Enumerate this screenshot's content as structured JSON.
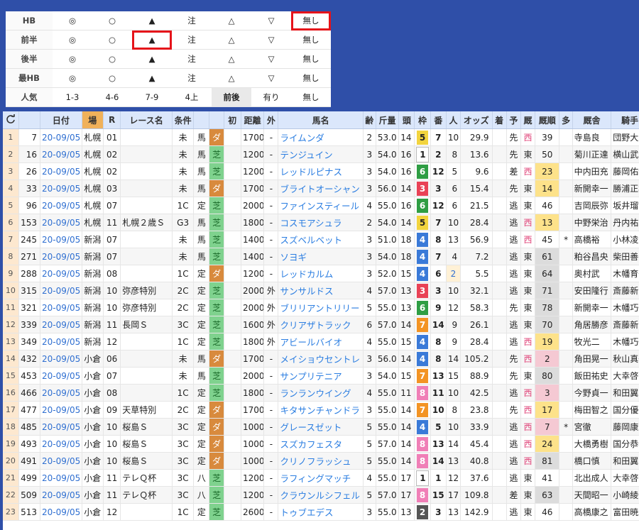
{
  "legend": {
    "rows": [
      {
        "label": "HB",
        "cells": [
          "◎",
          "○",
          "▲",
          "注",
          "△",
          "▽",
          "無し"
        ]
      },
      {
        "label": "前半",
        "cells": [
          "◎",
          "○",
          "▲",
          "注",
          "△",
          "▽",
          "無し"
        ]
      },
      {
        "label": "後半",
        "cells": [
          "◎",
          "○",
          "▲",
          "注",
          "△",
          "▽",
          "無し"
        ]
      },
      {
        "label": "最HB",
        "cells": [
          "◎",
          "○",
          "▲",
          "注",
          "△",
          "▽",
          "無し"
        ]
      },
      {
        "label": "人気",
        "cells": [
          "1-3",
          "4-6",
          "7-9",
          "4上",
          "前後",
          "有り",
          "無し"
        ]
      }
    ]
  },
  "grid": {
    "refresh_icon": "refresh-icon",
    "headers": [
      "",
      "日付",
      "場",
      "R",
      "レース名",
      "条件",
      "",
      "",
      "初",
      "距離",
      "外",
      "馬名",
      "齢",
      "斤量",
      "頭",
      "枠",
      "番",
      "人",
      "オッズ",
      "着",
      "予",
      "厩",
      "厩順",
      "多",
      "厩舎",
      "騎手"
    ],
    "rows": [
      {
        "idx": "1",
        "id": "7",
        "date": "20-09/05",
        "venue": "札幌",
        "r": "01",
        "race": "",
        "cond": "未",
        "ctype": "馬",
        "surf": "ダ",
        "first": "",
        "dist": "1700",
        "outer": "-",
        "horse": "ライムンダ",
        "age": "2",
        "weight": "53.0",
        "heads": "14",
        "frame": "5",
        "num": "7",
        "pop": "10",
        "odds": "29.9",
        "fin": "",
        "pred": "先",
        "barn": "西",
        "brank": "39",
        "multi": "",
        "trainer": "寺島良",
        "jockey": "団野大成"
      },
      {
        "idx": "2",
        "id": "16",
        "date": "20-09/05",
        "venue": "札幌",
        "r": "02",
        "race": "",
        "cond": "未",
        "ctype": "馬",
        "surf": "芝",
        "first": "",
        "dist": "1200",
        "outer": "-",
        "horse": "テンジュイン",
        "age": "3",
        "weight": "54.0",
        "heads": "16",
        "frame": "1",
        "num": "2",
        "pop": "8",
        "odds": "13.6",
        "fin": "",
        "pred": "先",
        "barn": "東",
        "brank": "50",
        "multi": "",
        "trainer": "菊川正達",
        "jockey": "横山武史"
      },
      {
        "idx": "3",
        "id": "26",
        "date": "20-09/05",
        "venue": "札幌",
        "r": "02",
        "race": "",
        "cond": "未",
        "ctype": "馬",
        "surf": "芝",
        "first": "",
        "dist": "1200",
        "outer": "-",
        "horse": "レッドルピナス",
        "age": "3",
        "weight": "54.0",
        "heads": "16",
        "frame": "6",
        "num": "12",
        "pop": "5",
        "odds": "9.6",
        "fin": "",
        "pred": "差",
        "barn": "西",
        "brank": "23",
        "multi": "",
        "trainer": "中内田充",
        "jockey": "藤岡佑介"
      },
      {
        "idx": "4",
        "id": "33",
        "date": "20-09/05",
        "venue": "札幌",
        "r": "03",
        "race": "",
        "cond": "未",
        "ctype": "馬",
        "surf": "ダ",
        "first": "",
        "dist": "1700",
        "outer": "-",
        "horse": "ブライトオーシャン",
        "age": "3",
        "weight": "56.0",
        "heads": "14",
        "frame": "3",
        "num": "3",
        "pop": "6",
        "odds": "15.4",
        "fin": "",
        "pred": "先",
        "barn": "東",
        "brank": "14",
        "multi": "",
        "trainer": "新開幸一",
        "jockey": "勝浦正樹"
      },
      {
        "idx": "5",
        "id": "96",
        "date": "20-09/05",
        "venue": "札幌",
        "r": "07",
        "race": "",
        "cond": "1C",
        "ctype": "定",
        "surf": "芝",
        "first": "",
        "dist": "2000",
        "outer": "-",
        "horse": "ファインスティール",
        "age": "4",
        "weight": "55.0",
        "heads": "16",
        "frame": "6",
        "num": "12",
        "pop": "6",
        "odds": "21.5",
        "fin": "",
        "pred": "逃",
        "barn": "東",
        "brank": "46",
        "multi": "",
        "trainer": "吉岡辰弥",
        "jockey": "坂井瑠星"
      },
      {
        "idx": "6",
        "id": "153",
        "date": "20-09/05",
        "venue": "札幌",
        "r": "11",
        "race": "札幌２歳Ｓ",
        "cond": "G3",
        "ctype": "馬",
        "surf": "芝",
        "first": "",
        "dist": "1800",
        "outer": "-",
        "horse": "コスモアシュラ",
        "age": "2",
        "weight": "54.0",
        "heads": "14",
        "frame": "5",
        "num": "7",
        "pop": "10",
        "odds": "28.4",
        "fin": "",
        "pred": "逃",
        "barn": "西",
        "brank": "13",
        "multi": "",
        "trainer": "中野栄治",
        "jockey": "丹内祐次"
      },
      {
        "idx": "7",
        "id": "245",
        "date": "20-09/05",
        "venue": "新潟",
        "r": "07",
        "race": "",
        "cond": "未",
        "ctype": "馬",
        "surf": "芝",
        "first": "",
        "dist": "1400",
        "outer": "-",
        "horse": "スズベルベット",
        "age": "3",
        "weight": "51.0",
        "heads": "18",
        "frame": "4",
        "num": "8",
        "pop": "13",
        "odds": "56.9",
        "fin": "",
        "pred": "逃",
        "barn": "西",
        "brank": "45",
        "multi": "*",
        "trainer": "高橋裕",
        "jockey": "小林凌大"
      },
      {
        "idx": "8",
        "id": "271",
        "date": "20-09/05",
        "venue": "新潟",
        "r": "07",
        "race": "",
        "cond": "未",
        "ctype": "馬",
        "surf": "芝",
        "first": "",
        "dist": "1400",
        "outer": "-",
        "horse": "ソヨギ",
        "age": "3",
        "weight": "54.0",
        "heads": "18",
        "frame": "4",
        "num": "7",
        "pop": "4",
        "odds": "7.2",
        "fin": "",
        "pred": "逃",
        "barn": "東",
        "brank": "61",
        "multi": "",
        "trainer": "粕谷昌央",
        "jockey": "柴田善臣"
      },
      {
        "idx": "9",
        "id": "288",
        "date": "20-09/05",
        "venue": "新潟",
        "r": "08",
        "race": "",
        "cond": "1C",
        "ctype": "定",
        "surf": "ダ",
        "first": "",
        "dist": "1200",
        "outer": "-",
        "horse": "レッドカルム",
        "age": "3",
        "weight": "52.0",
        "heads": "15",
        "frame": "4",
        "num": "6",
        "pop": "2",
        "odds": "5.5",
        "fin": "",
        "pred": "逃",
        "barn": "東",
        "brank": "64",
        "multi": "",
        "trainer": "奥村武",
        "jockey": "木幡育也"
      },
      {
        "idx": "10",
        "id": "315",
        "date": "20-09/05",
        "venue": "新潟",
        "r": "10",
        "race": "弥彦特別",
        "cond": "2C",
        "ctype": "定",
        "surf": "芝",
        "first": "",
        "dist": "2000",
        "outer": "外",
        "horse": "サンサルドス",
        "age": "4",
        "weight": "57.0",
        "heads": "13",
        "frame": "3",
        "num": "3",
        "pop": "10",
        "odds": "32.1",
        "fin": "",
        "pred": "逃",
        "barn": "東",
        "brank": "71",
        "multi": "",
        "trainer": "安田隆行",
        "jockey": "斎藤新"
      },
      {
        "idx": "11",
        "id": "321",
        "date": "20-09/05",
        "venue": "新潟",
        "r": "10",
        "race": "弥彦特別",
        "cond": "2C",
        "ctype": "定",
        "surf": "芝",
        "first": "",
        "dist": "2000",
        "outer": "外",
        "horse": "ブリリアントリリー",
        "age": "5",
        "weight": "55.0",
        "heads": "13",
        "frame": "6",
        "num": "9",
        "pop": "12",
        "odds": "58.3",
        "fin": "",
        "pred": "先",
        "barn": "東",
        "brank": "78",
        "multi": "",
        "trainer": "新開幸一",
        "jockey": "木幡巧也"
      },
      {
        "idx": "12",
        "id": "339",
        "date": "20-09/05",
        "venue": "新潟",
        "r": "11",
        "race": "長岡Ｓ",
        "cond": "3C",
        "ctype": "定",
        "surf": "芝",
        "first": "",
        "dist": "1600",
        "outer": "外",
        "horse": "クリアザトラック",
        "age": "6",
        "weight": "57.0",
        "heads": "14",
        "frame": "7",
        "num": "14",
        "pop": "9",
        "odds": "26.1",
        "fin": "",
        "pred": "逃",
        "barn": "東",
        "brank": "70",
        "multi": "",
        "trainer": "角居勝彦",
        "jockey": "斎藤新"
      },
      {
        "idx": "13",
        "id": "349",
        "date": "20-09/05",
        "venue": "新潟",
        "r": "12",
        "race": "",
        "cond": "1C",
        "ctype": "定",
        "surf": "芝",
        "first": "",
        "dist": "1800",
        "outer": "外",
        "horse": "アビールバイオ",
        "age": "4",
        "weight": "55.0",
        "heads": "15",
        "frame": "4",
        "num": "8",
        "pop": "9",
        "odds": "28.4",
        "fin": "",
        "pred": "逃",
        "barn": "西",
        "brank": "19",
        "multi": "",
        "trainer": "牧光二",
        "jockey": "木幡巧也"
      },
      {
        "idx": "14",
        "id": "432",
        "date": "20-09/05",
        "venue": "小倉",
        "r": "06",
        "race": "",
        "cond": "未",
        "ctype": "馬",
        "surf": "ダ",
        "first": "",
        "dist": "1700",
        "outer": "-",
        "horse": "メイショウセントレ",
        "age": "3",
        "weight": "56.0",
        "heads": "14",
        "frame": "4",
        "num": "8",
        "pop": "14",
        "odds": "105.2",
        "fin": "",
        "pred": "先",
        "barn": "西",
        "brank": "2",
        "multi": "",
        "trainer": "角田晃一",
        "jockey": "秋山真一"
      },
      {
        "idx": "15",
        "id": "453",
        "date": "20-09/05",
        "venue": "小倉",
        "r": "07",
        "race": "",
        "cond": "未",
        "ctype": "馬",
        "surf": "芝",
        "first": "",
        "dist": "2000",
        "outer": "-",
        "horse": "サンプリテニア",
        "age": "3",
        "weight": "54.0",
        "heads": "15",
        "frame": "7",
        "num": "13",
        "pop": "15",
        "odds": "88.9",
        "fin": "",
        "pred": "先",
        "barn": "東",
        "brank": "80",
        "multi": "",
        "trainer": "飯田祐史",
        "jockey": "大幸啓介"
      },
      {
        "idx": "16",
        "id": "466",
        "date": "20-09/05",
        "venue": "小倉",
        "r": "08",
        "race": "",
        "cond": "1C",
        "ctype": "定",
        "surf": "芝",
        "first": "",
        "dist": "1800",
        "outer": "-",
        "horse": "ランランウイング",
        "age": "4",
        "weight": "55.0",
        "heads": "11",
        "frame": "8",
        "num": "11",
        "pop": "10",
        "odds": "42.5",
        "fin": "",
        "pred": "逃",
        "barn": "西",
        "brank": "3",
        "multi": "",
        "trainer": "今野貞一",
        "jockey": "和田翼"
      },
      {
        "idx": "17",
        "id": "477",
        "date": "20-09/05",
        "venue": "小倉",
        "r": "09",
        "race": "天草特別",
        "cond": "2C",
        "ctype": "定",
        "surf": "ダ",
        "first": "",
        "dist": "1700",
        "outer": "-",
        "horse": "キタサンチャンドラ",
        "age": "3",
        "weight": "55.0",
        "heads": "14",
        "frame": "7",
        "num": "10",
        "pop": "8",
        "odds": "23.8",
        "fin": "",
        "pred": "先",
        "barn": "西",
        "brank": "17",
        "multi": "",
        "trainer": "梅田智之",
        "jockey": "国分優作"
      },
      {
        "idx": "18",
        "id": "485",
        "date": "20-09/05",
        "venue": "小倉",
        "r": "10",
        "race": "桜島Ｓ",
        "cond": "3C",
        "ctype": "定",
        "surf": "ダ",
        "first": "",
        "dist": "1000",
        "outer": "-",
        "horse": "グレースゼット",
        "age": "5",
        "weight": "55.0",
        "heads": "14",
        "frame": "4",
        "num": "5",
        "pop": "10",
        "odds": "33.9",
        "fin": "",
        "pred": "逃",
        "barn": "西",
        "brank": "7",
        "multi": "*",
        "trainer": "宮徹",
        "jockey": "藤岡康太"
      },
      {
        "idx": "19",
        "id": "493",
        "date": "20-09/05",
        "venue": "小倉",
        "r": "10",
        "race": "桜島Ｓ",
        "cond": "3C",
        "ctype": "定",
        "surf": "ダ",
        "first": "",
        "dist": "1000",
        "outer": "-",
        "horse": "スズカフェスタ",
        "age": "5",
        "weight": "57.0",
        "heads": "14",
        "frame": "8",
        "num": "13",
        "pop": "14",
        "odds": "45.4",
        "fin": "",
        "pred": "逃",
        "barn": "西",
        "brank": "24",
        "multi": "",
        "trainer": "大橋勇樹",
        "jockey": "国分恭介"
      },
      {
        "idx": "20",
        "id": "491",
        "date": "20-09/05",
        "venue": "小倉",
        "r": "10",
        "race": "桜島Ｓ",
        "cond": "3C",
        "ctype": "定",
        "surf": "ダ",
        "first": "",
        "dist": "1000",
        "outer": "-",
        "horse": "クリノフラッシュ",
        "age": "5",
        "weight": "55.0",
        "heads": "14",
        "frame": "8",
        "num": "14",
        "pop": "13",
        "odds": "40.8",
        "fin": "",
        "pred": "逃",
        "barn": "西",
        "brank": "81",
        "multi": "",
        "trainer": "橋口慎",
        "jockey": "和田翼"
      },
      {
        "idx": "21",
        "id": "499",
        "date": "20-09/05",
        "venue": "小倉",
        "r": "11",
        "race": "テレＱ杯",
        "cond": "3C",
        "ctype": "八",
        "surf": "芝",
        "first": "",
        "dist": "1200",
        "outer": "-",
        "horse": "ラフィングマッチ",
        "age": "4",
        "weight": "55.0",
        "heads": "17",
        "frame": "1",
        "num": "1",
        "pop": "12",
        "odds": "37.6",
        "fin": "",
        "pred": "逃",
        "barn": "東",
        "brank": "41",
        "multi": "",
        "trainer": "北出成人",
        "jockey": "大幸啓介"
      },
      {
        "idx": "22",
        "id": "509",
        "date": "20-09/05",
        "venue": "小倉",
        "r": "11",
        "race": "テレＱ杯",
        "cond": "3C",
        "ctype": "八",
        "surf": "芝",
        "first": "",
        "dist": "1200",
        "outer": "-",
        "horse": "クラウンルシフェル",
        "age": "5",
        "weight": "57.0",
        "heads": "17",
        "frame": "8",
        "num": "15",
        "pop": "17",
        "odds": "109.8",
        "fin": "",
        "pred": "差",
        "barn": "東",
        "brank": "63",
        "multi": "",
        "trainer": "天間昭一",
        "jockey": "小崎綾也"
      },
      {
        "idx": "23",
        "id": "513",
        "date": "20-09/05",
        "venue": "小倉",
        "r": "12",
        "race": "",
        "cond": "1C",
        "ctype": "定",
        "surf": "芝",
        "first": "",
        "dist": "2600",
        "outer": "-",
        "horse": "トゥブエデス",
        "age": "3",
        "weight": "55.0",
        "heads": "13",
        "frame": "2",
        "num": "3",
        "pop": "13",
        "odds": "142.9",
        "fin": "",
        "pred": "逃",
        "barn": "東",
        "brank": "46",
        "multi": "",
        "trainer": "高橋康之",
        "jockey": "富田暁"
      }
    ]
  }
}
